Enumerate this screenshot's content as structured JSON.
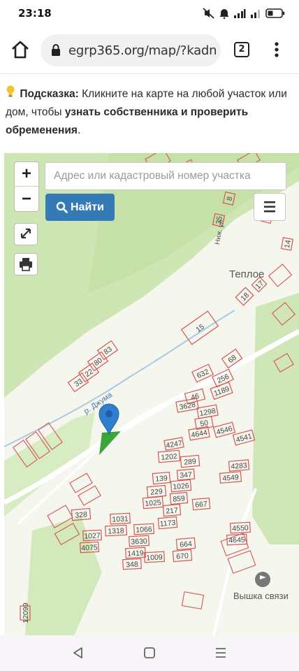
{
  "status": {
    "time": "23:18"
  },
  "browser": {
    "url": "egrp365.org/map/?kadn",
    "tab_count": "2"
  },
  "hint": {
    "label": "Подсказка:",
    "text_1": " Кликните на карте на любой участок или дом, чтобы ",
    "bold_text": "узнать собственника и проверить обременения",
    "text_2": "."
  },
  "map": {
    "search_placeholder": "Адрес или кадастровый номер участка",
    "find_label": "Найти",
    "zoom_in": "+",
    "zoom_out": "−",
    "place_label": "Теплое",
    "tower_label": "Вышка связи",
    "river_label": "р. Джума",
    "street_label": "Ниж. ул.",
    "parcel_numbers": [
      "83",
      "80",
      "22",
      "33",
      "15",
      "68",
      "632",
      "256",
      "1189",
      "46",
      "3628",
      "1298",
      "50",
      "4644",
      "4546",
      "4541",
      "4247",
      "1202",
      "289",
      "347",
      "4283",
      "4549",
      "139",
      "1026",
      "229",
      "859",
      "1025",
      "217",
      "667",
      "1173",
      "328",
      "1031",
      "1318",
      "1066",
      "3630",
      "1027",
      "4075",
      "1419",
      "1009",
      "348",
      "664",
      "670",
      "4550",
      "4645",
      "8",
      "35",
      "2",
      "17",
      "18",
      "14",
      "12099"
    ]
  },
  "colors": {
    "parcel_stroke": "#d9534f",
    "forest": "#cfe7b6",
    "water": "#aac6de",
    "button_primary": "#337ab7",
    "marker": "#2f7fd0",
    "selected_parcel": "#3aa63a"
  }
}
